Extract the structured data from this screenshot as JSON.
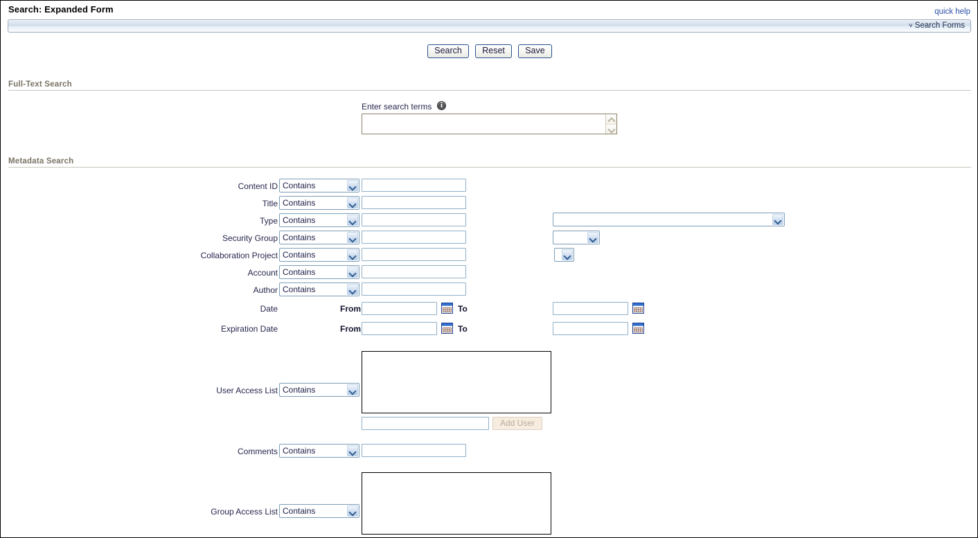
{
  "header": {
    "title": "Search: Expanded Form",
    "quick_help": "quick help",
    "search_forms_label": "Search Forms",
    "chevron": "˅"
  },
  "toolbar": {
    "search_label": "Search",
    "reset_label": "Reset",
    "save_label": "Save"
  },
  "fulltext": {
    "section_title": "Full-Text Search",
    "field_label": "Enter search terms",
    "value": "",
    "info_tooltip": "i"
  },
  "metadata": {
    "section_title": "Metadata Search",
    "operator_default": "Contains",
    "rows": [
      {
        "label": "Content ID",
        "operator": "Contains",
        "value": ""
      },
      {
        "label": "Title",
        "operator": "Contains",
        "value": ""
      },
      {
        "label": "Type",
        "operator": "Contains",
        "value": "",
        "extra_select": "",
        "extra_width": "wide"
      },
      {
        "label": "Security Group",
        "operator": "Contains",
        "value": "",
        "extra_select": "",
        "extra_width": "medium"
      },
      {
        "label": "Collaboration Project",
        "operator": "Contains",
        "value": "",
        "extra_select": "",
        "extra_width": "small"
      },
      {
        "label": "Account",
        "operator": "Contains",
        "value": ""
      },
      {
        "label": "Author",
        "operator": "Contains",
        "value": ""
      }
    ],
    "date_rows": [
      {
        "label": "Date",
        "from_label": "From",
        "from_value": "",
        "to_label": "To",
        "to_value": ""
      },
      {
        "label": "Expiration Date",
        "from_label": "From",
        "from_value": "",
        "to_label": "To",
        "to_value": ""
      }
    ],
    "user_access": {
      "label": "User Access List",
      "operator": "Contains",
      "list_value": "",
      "add_input_value": "",
      "add_button_label": "Add User"
    },
    "comments": {
      "label": "Comments",
      "operator": "Contains",
      "value": ""
    },
    "group_access": {
      "label": "Group Access List",
      "operator": "Contains",
      "list_value": ""
    }
  },
  "icons": {
    "calendar": "calendar-icon",
    "info": "info-icon",
    "chevron_down": "chevron-down-icon"
  },
  "colors": {
    "link": "#2a4ea8",
    "section_heading": "#7a7364",
    "label": "#26264e",
    "select_border": "#7d9db8",
    "input_border": "#8fb0c8"
  }
}
